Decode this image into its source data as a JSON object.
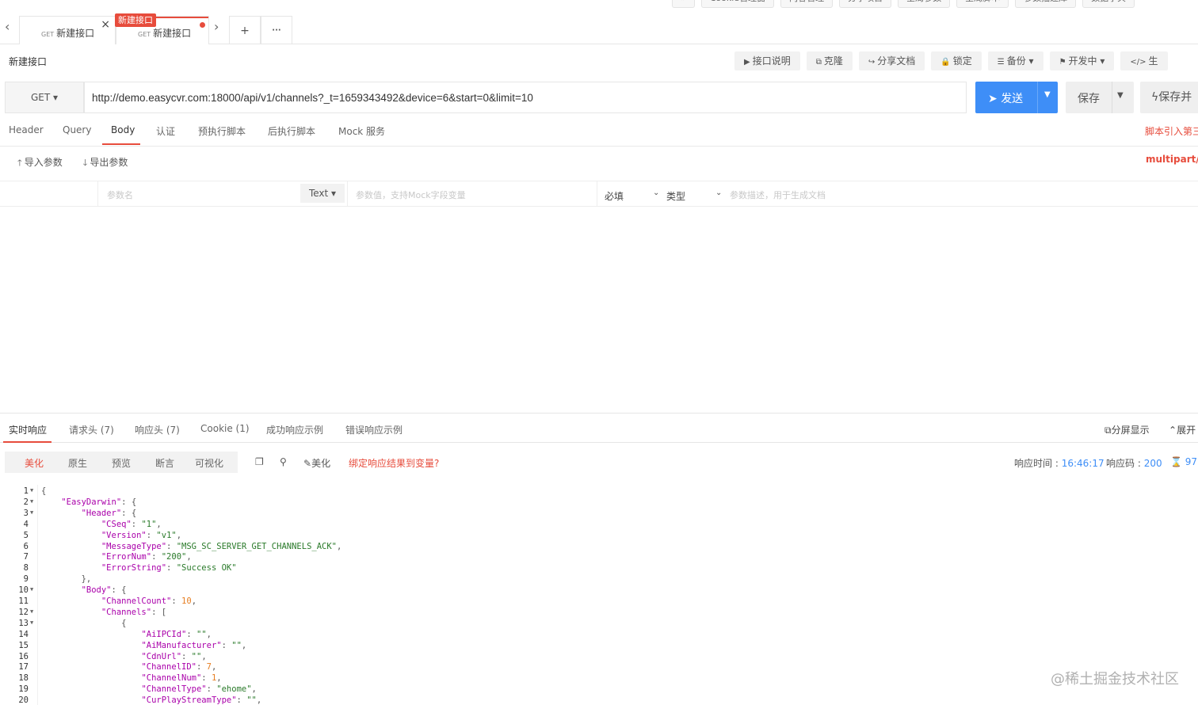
{
  "top_tools": [
    "»",
    "Cookie管理器",
    "内容管理",
    "分享项目",
    "全局参数",
    "全局脚本",
    "参数描述库",
    "数据字典"
  ],
  "tabs": [
    {
      "method": "GET",
      "title": "新建接口"
    },
    {
      "method": "GET",
      "title": "新建接口",
      "badge": "新建接口"
    }
  ],
  "tab_buttons": {
    "add": "+",
    "more": "···",
    "prev": "‹",
    "next": "›",
    "close": "×"
  },
  "api_title": "新建接口",
  "actions": [
    {
      "icon": "▶",
      "label": "接口说明"
    },
    {
      "icon": "⧉",
      "label": "克隆"
    },
    {
      "icon": "↪",
      "label": "分享文档"
    },
    {
      "icon": "🔒",
      "label": "锁定"
    },
    {
      "icon": "☰",
      "label": "备份 ▾"
    },
    {
      "icon": "⚑",
      "label": "开发中 ▾"
    },
    {
      "icon": "</>",
      "label": "生"
    }
  ],
  "request": {
    "method": "GET ▾",
    "url": "http://demo.easycvr.com:18000/api/v1/channels?_t=1659343492&device=6&start=0&limit=10",
    "send": "发送",
    "save": "保存",
    "save_run": "保存并"
  },
  "request_tabs": [
    "Header",
    "Query",
    "Body",
    "认证",
    "预执行脚本",
    "后执行脚本",
    "Mock 服务"
  ],
  "script_link": "脚本引入第三",
  "import_label": "导入参数",
  "export_label": "导出参数",
  "content_type": "multipart/fo",
  "param_row": {
    "name_placeholder": "参数名",
    "type": "Text ▾",
    "value_placeholder": "参数值，支持Mock字段变量",
    "required": "必填",
    "type_label": "类型",
    "desc_placeholder": "参数描述，用于生成文档"
  },
  "response_tabs": [
    "实时响应",
    "请求头 (7)",
    "响应头 (7)",
    "Cookie (1)",
    "成功响应示例",
    "错误响应示例"
  ],
  "split_view": "分屏显示",
  "expand": "展开",
  "view_modes": [
    "美化",
    "原生",
    "预览",
    "断言",
    "可视化"
  ],
  "beautify": "美化",
  "bind_link": "绑定响应结果到变量?",
  "response_meta": {
    "time_label": "响应时间 : ",
    "time": "16:46:17",
    "code_label": "响应码 : ",
    "code": "200",
    "size": "97"
  },
  "code_lines": [
    {
      "n": "1",
      "fold": true,
      "text": "{"
    },
    {
      "n": "2",
      "fold": true,
      "text": "    \"EasyDarwin\": {"
    },
    {
      "n": "3",
      "fold": true,
      "text": "        \"Header\": {"
    },
    {
      "n": "4",
      "fold": false,
      "text": "            \"CSeq\": \"1\","
    },
    {
      "n": "5",
      "fold": false,
      "text": "            \"Version\": \"v1\","
    },
    {
      "n": "6",
      "fold": false,
      "text": "            \"MessageType\": \"MSG_SC_SERVER_GET_CHANNELS_ACK\","
    },
    {
      "n": "7",
      "fold": false,
      "text": "            \"ErrorNum\": \"200\","
    },
    {
      "n": "8",
      "fold": false,
      "text": "            \"ErrorString\": \"Success OK\""
    },
    {
      "n": "9",
      "fold": false,
      "text": "        },"
    },
    {
      "n": "10",
      "fold": true,
      "text": "        \"Body\": {"
    },
    {
      "n": "11",
      "fold": false,
      "text": "            \"ChannelCount\": 10,"
    },
    {
      "n": "12",
      "fold": true,
      "text": "            \"Channels\": ["
    },
    {
      "n": "13",
      "fold": true,
      "text": "                {"
    },
    {
      "n": "14",
      "fold": false,
      "text": "                    \"AiIPCId\": \"\","
    },
    {
      "n": "15",
      "fold": false,
      "text": "                    \"AiManufacturer\": \"\","
    },
    {
      "n": "16",
      "fold": false,
      "text": "                    \"CdnUrl\": \"\","
    },
    {
      "n": "17",
      "fold": false,
      "text": "                    \"ChannelID\": 7,"
    },
    {
      "n": "18",
      "fold": false,
      "text": "                    \"ChannelNum\": 1,"
    },
    {
      "n": "19",
      "fold": false,
      "text": "                    \"ChannelType\": \"ehome\","
    },
    {
      "n": "20",
      "fold": false,
      "text": "                    \"CurPlayStreamType\": \"\","
    }
  ],
  "watermark": "@稀土掘金技术社区",
  "colors": {
    "accent": "#e74c3c",
    "primary": "#3e8ef7"
  }
}
